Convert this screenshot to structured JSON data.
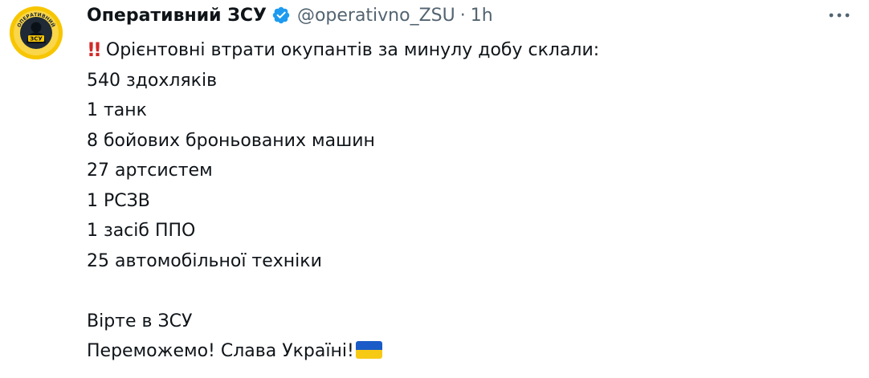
{
  "author": {
    "display_name": "Оперативний ЗСУ",
    "handle": "@operativno_ZSU",
    "separator": "·",
    "time": "1h",
    "avatar_icon": "zsu-operative-logo",
    "verified_icon": "verified-badge-icon"
  },
  "tweet": {
    "headline": "Орієнтовні втрати окупантів за минулу добу склали:",
    "headline_prefix_icon": "double-exclamation-icon",
    "losses": [
      "540 здохляків",
      "1 танк",
      "8 бойових броньованих машин",
      "27 артсистем",
      "1 РСЗВ",
      "1 засіб ППО",
      "25 автомобільної техніки"
    ],
    "closing_1": "Вірте в ЗСУ",
    "closing_2": "Переможемо! Слава Україні!",
    "closing_suffix_icon": "ukraine-flag-icon"
  },
  "colors": {
    "text": "#0f1419",
    "secondary": "#536471",
    "verified": "#1d9bf0",
    "exclamation": "#d12a2a",
    "flag_blue": "#1a5bc8",
    "flag_yellow": "#f6c915",
    "avatar_bg": "#f7c600"
  },
  "more_icon": "more-options-icon"
}
